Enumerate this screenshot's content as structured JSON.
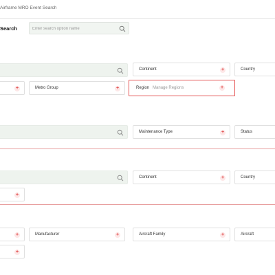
{
  "breadcrumb": "Airframe MRO Event Search",
  "search": {
    "label": "Search",
    "placeholder": "Enter search option name"
  },
  "section1": {
    "continent": "Continent",
    "country": "Country",
    "metro_group": "Metro Group",
    "region": "Region",
    "region_link": "Manage Regions"
  },
  "section2": {
    "maintenance_type": "Maintenance Type",
    "status": "Status"
  },
  "section3": {
    "continent": "Continent",
    "country": "Country"
  },
  "section4": {
    "manufacturer": "Manufacturer",
    "aircraft_family": "Aircraft Family",
    "aircraft": "Aircraft"
  },
  "add_symbol": "+"
}
